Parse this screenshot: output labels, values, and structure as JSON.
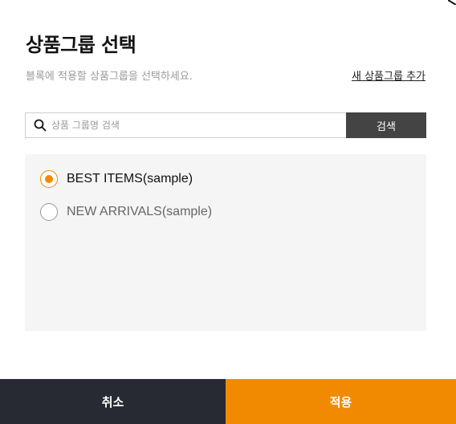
{
  "dialog": {
    "title": "상품그룹 선택",
    "subtitle": "블록에 적용할 상품그룹을 선택하세요.",
    "add_link": "새 상품그룹 추가"
  },
  "search": {
    "icon": "search-icon",
    "placeholder": "상품 그룹명 검색",
    "value": "",
    "button_label": "검색"
  },
  "groups": {
    "items": [
      {
        "label": "BEST ITEMS(sample)",
        "selected": true
      },
      {
        "label": "NEW ARRIVALS(sample)",
        "selected": false
      }
    ]
  },
  "footer": {
    "cancel_label": "취소",
    "apply_label": "적용"
  },
  "colors": {
    "accent": "#f28a00",
    "cancel_bg": "#272a33",
    "search_button_bg": "#444444",
    "panel_bg": "#f5f5f5"
  }
}
